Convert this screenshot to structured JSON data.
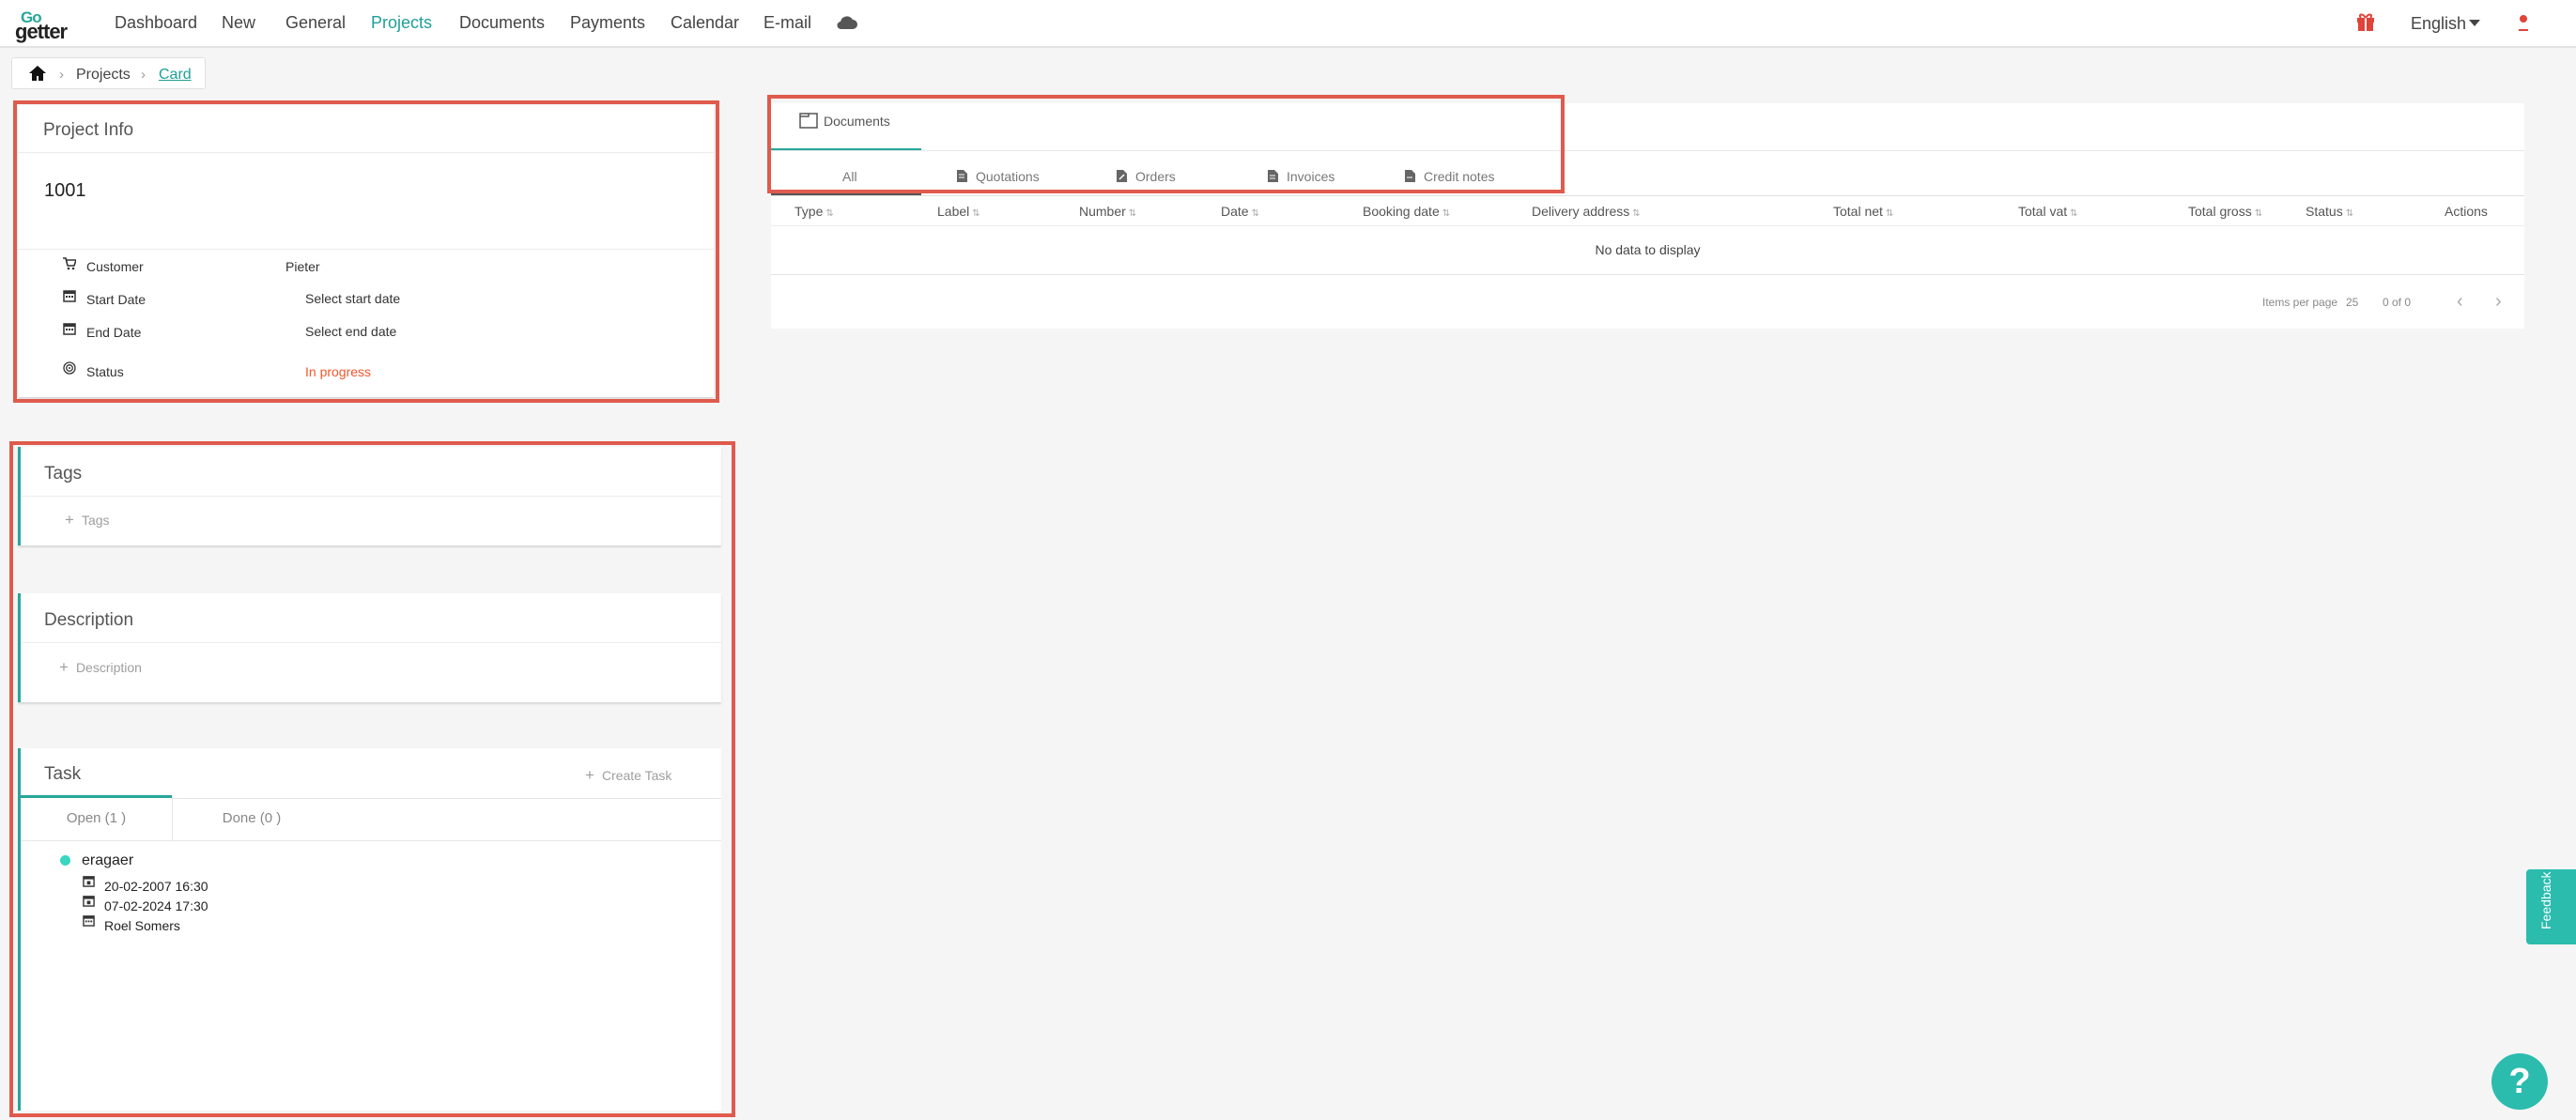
{
  "app": {
    "logo_top": "Go",
    "logo_bottom": "getter"
  },
  "nav": {
    "items": [
      "Dashboard",
      "New",
      "General",
      "Projects",
      "Documents",
      "Payments",
      "Calendar",
      "E-mail"
    ],
    "active": "Projects",
    "language": "English",
    "icons": [
      "cloud-icon",
      "gift-icon",
      "user-icon"
    ]
  },
  "breadcrumb": {
    "home_icon": "home-icon",
    "items": [
      "Projects",
      "Card"
    ]
  },
  "project_info": {
    "title": "Project Info",
    "number": "1001",
    "rows": [
      {
        "icon": "cart-icon",
        "label": "Customer",
        "value": "Pieter"
      },
      {
        "icon": "calendar-icon",
        "label": "Start Date",
        "value": "Select start date"
      },
      {
        "icon": "calendar-icon",
        "label": "End Date",
        "value": "Select end date"
      },
      {
        "icon": "target-icon",
        "label": "Status",
        "value": "In progress"
      }
    ]
  },
  "tags": {
    "title": "Tags",
    "add_label": "Tags"
  },
  "description": {
    "title": "Description",
    "add_label": "Description"
  },
  "task": {
    "title": "Task",
    "create_label": "Create Task",
    "tabs": [
      "Open (1 )",
      "Done (0 )"
    ],
    "active_tab": "Open (1 )",
    "items": [
      {
        "name": "eragaer",
        "start": "20-02-2007 16:30",
        "end": "07-02-2024 17:30",
        "assignee": "Roel Somers"
      }
    ]
  },
  "documents": {
    "tab_label": "Documents",
    "sub_tabs": [
      "All",
      "Quotations",
      "Orders",
      "Invoices",
      "Credit notes"
    ],
    "active_sub_tab": "All",
    "columns": [
      "Type",
      "Label",
      "Number",
      "Date",
      "Booking date",
      "Delivery address",
      "Total net",
      "Total vat",
      "Total gross",
      "Status",
      "Actions"
    ],
    "empty_text": "No data to display",
    "items_per_page_label": "Items per page",
    "items_per_page": "25",
    "range": "0 of 0"
  },
  "feedback_label": "Feedback",
  "help_label": "?",
  "colors": {
    "accent": "#26a69a",
    "status_in_progress": "#f2572b",
    "highlight_frame": "#e05a4d"
  }
}
